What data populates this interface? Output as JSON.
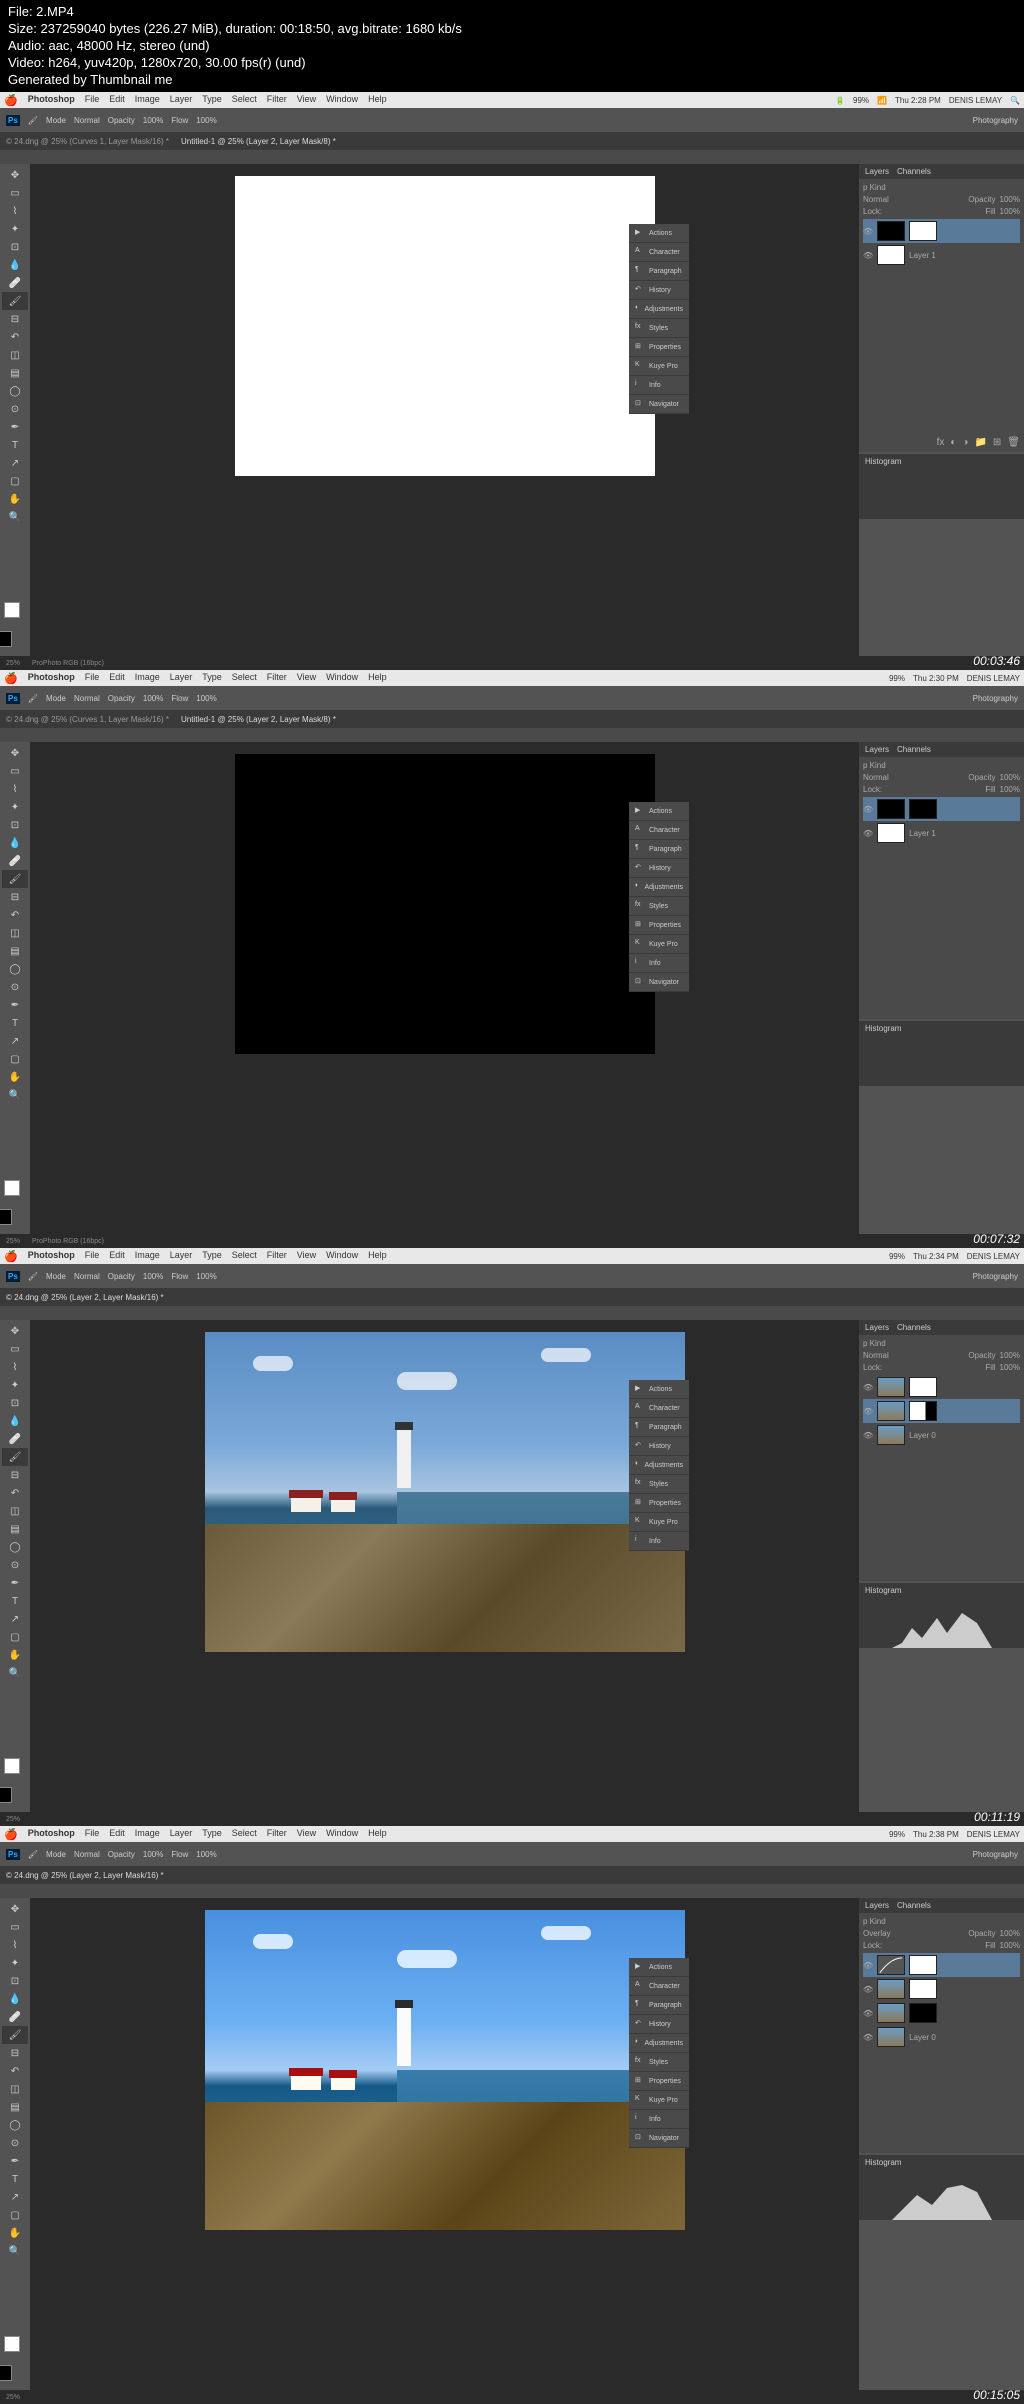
{
  "file_info": {
    "file": "File: 2.MP4",
    "size": "Size: 237259040 bytes (226.27 MiB), duration: 00:18:50, avg.bitrate: 1680 kb/s",
    "audio": "Audio: aac, 48000 Hz, stereo (und)",
    "video": "Video: h264, yuv420p, 1280x720, 30.00 fps(r) (und)",
    "generated": "Generated by Thumbnail me"
  },
  "menubar": {
    "app": "Photoshop",
    "items": [
      "File",
      "Edit",
      "Image",
      "Layer",
      "Type",
      "Select",
      "Filter",
      "View",
      "Window",
      "Help"
    ],
    "status": {
      "battery": "99%",
      "user": "DENIS LEMAY"
    }
  },
  "options": {
    "mode": "Mode",
    "normal": "Normal",
    "opacity": "Opacity",
    "opacity_val": "100%",
    "flow": "Flow",
    "flow_val": "100%",
    "workspace": "Photography"
  },
  "doc_tabs": {
    "tab1": "© 24.dng @ 25% (Curves 1, Layer Mask/16) *",
    "tab2_f1": "Untitled-1 @ 25% (Layer 2, Layer Mask/8) *",
    "tab2_f3": "© 24.dng @ 25% (Layer 2, Layer Mask/16) *"
  },
  "floating_panel": {
    "items": [
      "Actions",
      "Character",
      "Paragraph",
      "History",
      "Adjustments",
      "Styles",
      "Properties",
      "Kuye Pro",
      "Info",
      "Navigator"
    ]
  },
  "layers_panel": {
    "header": "Layers",
    "channels": "Channels",
    "kind": "p Kind",
    "blend": "Normal",
    "opacity_label": "Opacity",
    "opacity_val": "100%",
    "lock": "Lock:",
    "fill_label": "Fill",
    "fill_val": "100%",
    "layer1": "Layer 1",
    "layer0": "Layer 0",
    "overlay": "Overlay"
  },
  "histogram_panel": {
    "header": "Histogram"
  },
  "status": {
    "zoom": "25%",
    "profile": "ProPhoto RGB (16bpc)"
  },
  "frames": [
    {
      "time": "Thu 2:28 PM",
      "timestamp": "00:03:46"
    },
    {
      "time": "Thu 2:30 PM",
      "timestamp": "00:07:32"
    },
    {
      "time": "Thu 2:34 PM",
      "timestamp": "00:11:19"
    },
    {
      "time": "Thu 2:38 PM",
      "timestamp": "00:15:05"
    }
  ]
}
